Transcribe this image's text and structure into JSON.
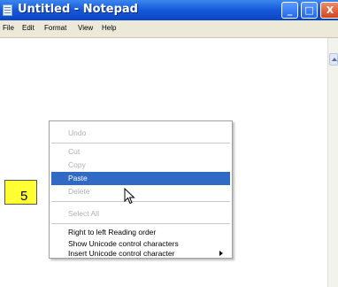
{
  "window": {
    "title": "Untitled - Notepad",
    "buttons": {
      "minimize": "_",
      "maximize": "□",
      "close": "X"
    }
  },
  "menu": [
    "File",
    "Edit",
    "Format",
    "View",
    "Help"
  ],
  "context_menu": {
    "items": [
      {
        "label": "Undo",
        "enabled": false
      },
      {
        "label": "Cut",
        "enabled": false
      },
      {
        "label": "Copy",
        "enabled": false
      },
      {
        "label": "Paste",
        "enabled": true,
        "highlighted": true
      },
      {
        "label": "Delete",
        "enabled": false
      },
      {
        "label": "Select All",
        "enabled": false
      },
      {
        "label": "Right to left Reading order",
        "enabled": true
      },
      {
        "label": "Show Unicode control characters",
        "enabled": true
      },
      {
        "label": "Insert Unicode control character",
        "enabled": true,
        "submenu": true
      }
    ]
  },
  "step_marker": {
    "number": "5"
  },
  "colors": {
    "highlight": "#316ac5",
    "titlebar": "#1658d8",
    "marker": "#ffff33",
    "menubar": "#ece9d8"
  },
  "icons": [
    "notepad-app-icon",
    "minimize-icon",
    "maximize-icon",
    "close-icon",
    "mouse-pointer-icon",
    "submenu-arrow-icon",
    "scroll-up-arrow-icon"
  ]
}
